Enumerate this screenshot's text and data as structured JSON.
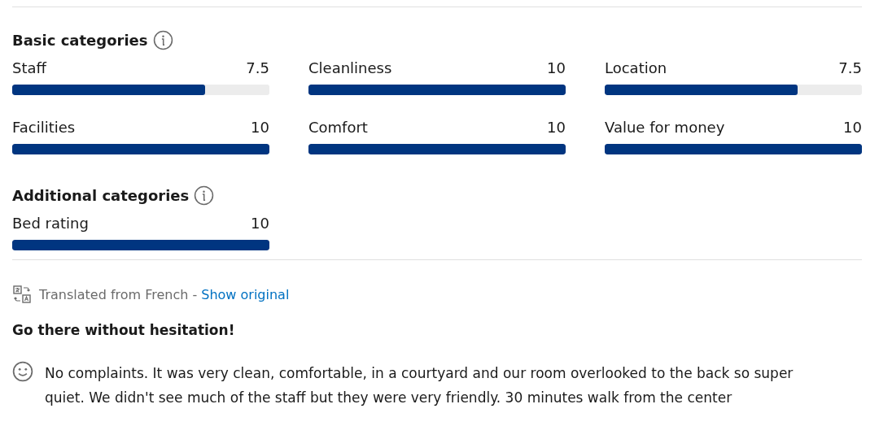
{
  "basic_categories": {
    "title": "Basic categories",
    "items": [
      {
        "label": "Staff",
        "score": "7.5",
        "level": 0.75
      },
      {
        "label": "Cleanliness",
        "score": "10",
        "level": 1
      },
      {
        "label": "Location",
        "score": "7.5",
        "level": 0.75
      },
      {
        "label": "Facilities",
        "score": "10",
        "level": 1
      },
      {
        "label": "Comfort",
        "score": "10",
        "level": 1
      },
      {
        "label": "Value for money",
        "score": "10",
        "level": 1
      }
    ]
  },
  "additional_categories": {
    "title": "Additional categories",
    "items": [
      {
        "label": "Bed rating",
        "score": "10",
        "level": 1
      }
    ]
  },
  "translation": {
    "note": "Translated from French -",
    "link": "Show original"
  },
  "review": {
    "title": "Go there without hesitation!",
    "positive": "No complaints. It was very clean, comfortable, in a courtyard and our room overlooked to the back so super quiet. We didn't see much of the staff but they were very friendly. 30 minutes walk from the center"
  }
}
